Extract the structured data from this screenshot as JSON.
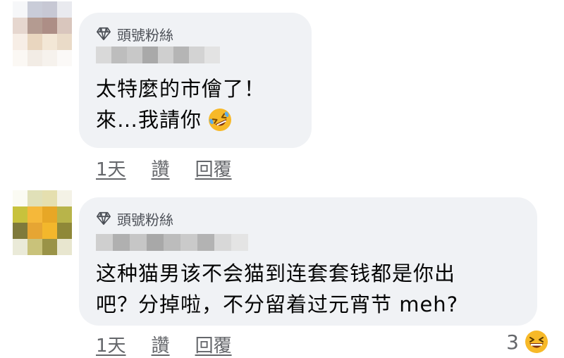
{
  "colors": {
    "bubble_bg": "#f0f2f5",
    "meta_text": "#65676b",
    "body_text": "#050505",
    "emoji_yellow": "#f7b928"
  },
  "comments": [
    {
      "badge_icon": "diamond-icon",
      "badge_label": "頭號粉絲",
      "lines": [
        "太特麼的市儈了！",
        "來…我請你"
      ],
      "emoji": "rolling-on-floor-laughing-emoji",
      "actions": {
        "time": "1天",
        "like": "讚",
        "reply": "回覆"
      }
    },
    {
      "badge_icon": "diamond-icon",
      "badge_label": "頭號粉絲",
      "lines": [
        "这种猫男该不会猫到连套套钱都是你出",
        "吧？分掉啦，不分留着过元宵节 meh?"
      ],
      "actions": {
        "time": "1天",
        "like": "讚",
        "reply": "回覆"
      },
      "reaction": {
        "count": "3",
        "emoji": "grinning-squinting-face-emoji"
      }
    }
  ]
}
